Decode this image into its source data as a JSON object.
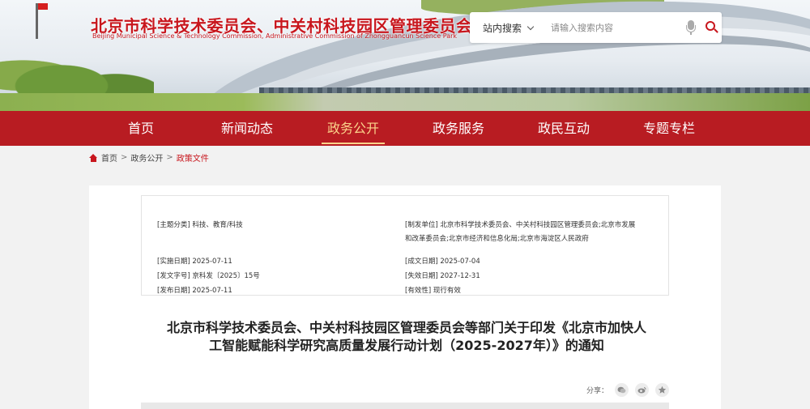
{
  "header": {
    "title_cn": "北京市科学技术委员会、中关村科技园区管理委员会",
    "title_en": "Beijing Municipal Science & Technology Commission, Administrative Commission of Zhongguancun Science Park"
  },
  "search": {
    "scope": "站内搜索",
    "placeholder": "请输入搜索内容"
  },
  "nav": {
    "items": [
      {
        "label": "首页"
      },
      {
        "label": "新闻动态"
      },
      {
        "label": "政务公开"
      },
      {
        "label": "政务服务"
      },
      {
        "label": "政民互动"
      },
      {
        "label": "专题专栏"
      }
    ],
    "active_index": 2,
    "active_color": "#fbd38b",
    "bar_color": "#b81c22"
  },
  "breadcrumb": {
    "items": [
      "首页",
      "政务公开",
      "政策文件"
    ],
    "separator": ">"
  },
  "meta": {
    "category_key": "[主题分类]",
    "category_val": "科技、教育/科技",
    "issuer_key": "[制发单位]",
    "issuer_val": "北京市科学技术委员会、中关村科技园区管理委员会;北京市发展",
    "issuer_val2": "和改革委员会;北京市经济和信息化局;北京市海淀区人民政府",
    "impl_key": "[实施日期]",
    "impl_val": "2025-07-11",
    "formed_key": "[成文日期]",
    "formed_val": "2025-07-04",
    "docno_key": "[发文字号]",
    "docno_val": "京科发〔2025〕15号",
    "expiry_key": "[失效日期]",
    "expiry_val": "2027-12-31",
    "publish_key": "[发布日期]",
    "publish_val": "2025-07-11",
    "validity_key": "[有效性]",
    "validity_val": "现行有效"
  },
  "article": {
    "title": "北京市科学技术委员会、中关村科技园区管理委员会等部门关于印发《北京市加快人工智能赋能科学研究高质量发展行动计划（2025-2027年）》的通知"
  },
  "share": {
    "label": "分享：",
    "buttons": [
      "wechat-icon",
      "weibo-icon",
      "favorite-icon"
    ]
  }
}
